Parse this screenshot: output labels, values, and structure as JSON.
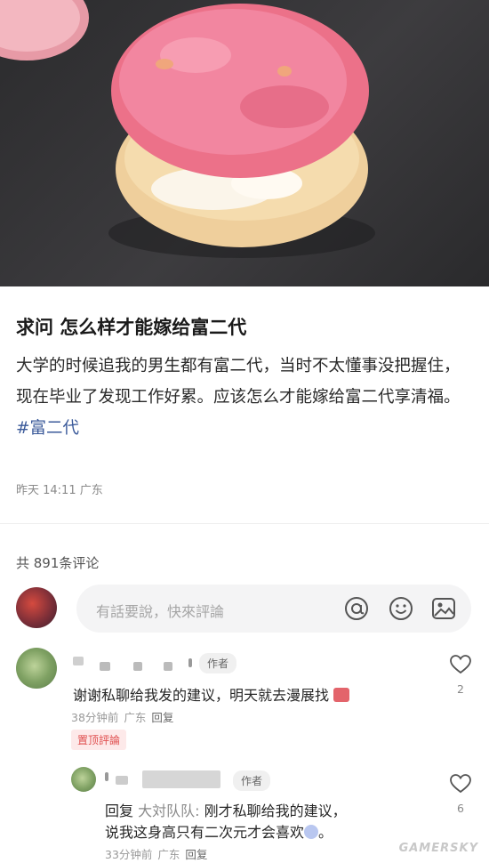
{
  "post": {
    "title": "求问 怎么样才能嫁给富二代",
    "body": "大学的时候追我的男生都有富二代，当时不太懂事没把握住，现在毕业了发现工作好累。应该怎么才能嫁给富二代享清福。",
    "tag": "#富二代",
    "time": "昨天 14:11",
    "location": "广东"
  },
  "comments_header": {
    "count_label": "共 891条评论"
  },
  "input": {
    "placeholder": "有話要說，快來評論"
  },
  "comments": [
    {
      "badge": "作者",
      "text": "谢谢私聊给我发的建议，明天就去漫展找",
      "time": "38分钟前",
      "location": "广东",
      "reply_label": "回复",
      "pin_label": "置顶評論",
      "likes": "2"
    },
    {
      "badge": "作者",
      "reply_prefix": "回复",
      "reply_to": "大対队队:",
      "text_line1": "刚才私聊给我的建议，",
      "text_line2": "说我这身高只有二次元才会喜欢",
      "time": "33分钟前",
      "location": "广东",
      "reply_label": "回复",
      "likes": "6"
    }
  ],
  "watermark": "GAMERSKY",
  "colors": {
    "tag": "#3b5a9a",
    "pin": "#e04e4e",
    "pink_topping": "#f07f98"
  }
}
